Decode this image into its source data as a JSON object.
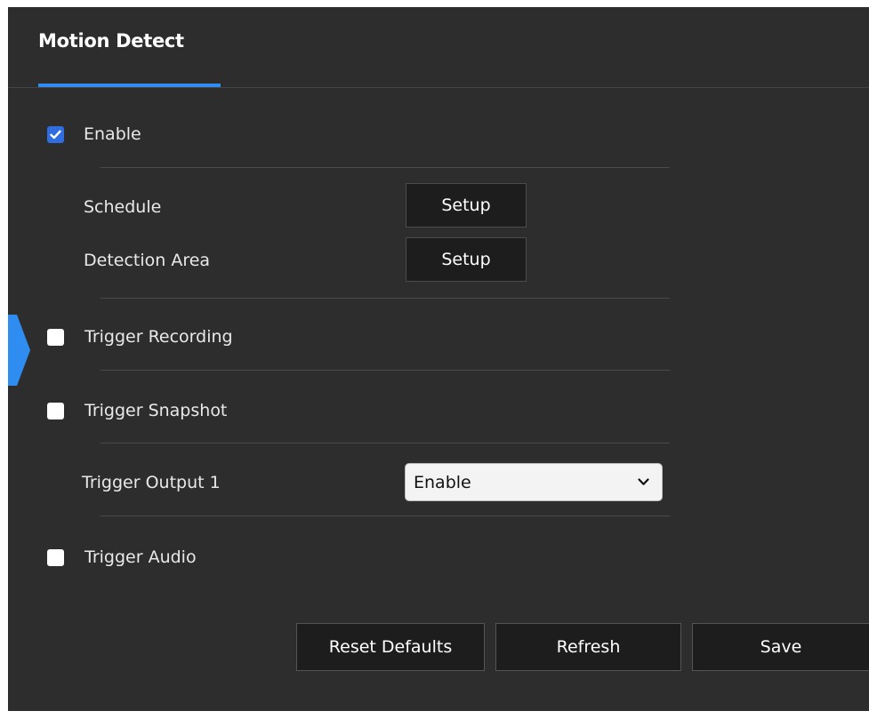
{
  "header": {
    "tab_title": "Motion Detect"
  },
  "enable": {
    "label": "Enable",
    "checked": true
  },
  "schedule": {
    "label": "Schedule",
    "button": "Setup"
  },
  "detection_area": {
    "label": "Detection Area",
    "button": "Setup"
  },
  "trigger_recording": {
    "label": "Trigger Recording",
    "checked": false
  },
  "trigger_snapshot": {
    "label": "Trigger Snapshot",
    "checked": false
  },
  "trigger_output": {
    "label": "Trigger Output 1",
    "value": "Enable"
  },
  "trigger_audio": {
    "label": "Trigger Audio",
    "checked": false
  },
  "actions": {
    "reset_label": "Reset Defaults",
    "refresh_label": "Refresh",
    "save_label": "Save"
  },
  "colors": {
    "panel_bg": "#2d2d2d",
    "accent": "#2f8cf0",
    "checkbox_checked": "#2f6de0",
    "button_bg": "#1d1d1d"
  },
  "icons": {
    "checked": "checkmark-icon",
    "select_arrow": "chevron-down-icon",
    "side_marker": "side-expand-marker"
  }
}
